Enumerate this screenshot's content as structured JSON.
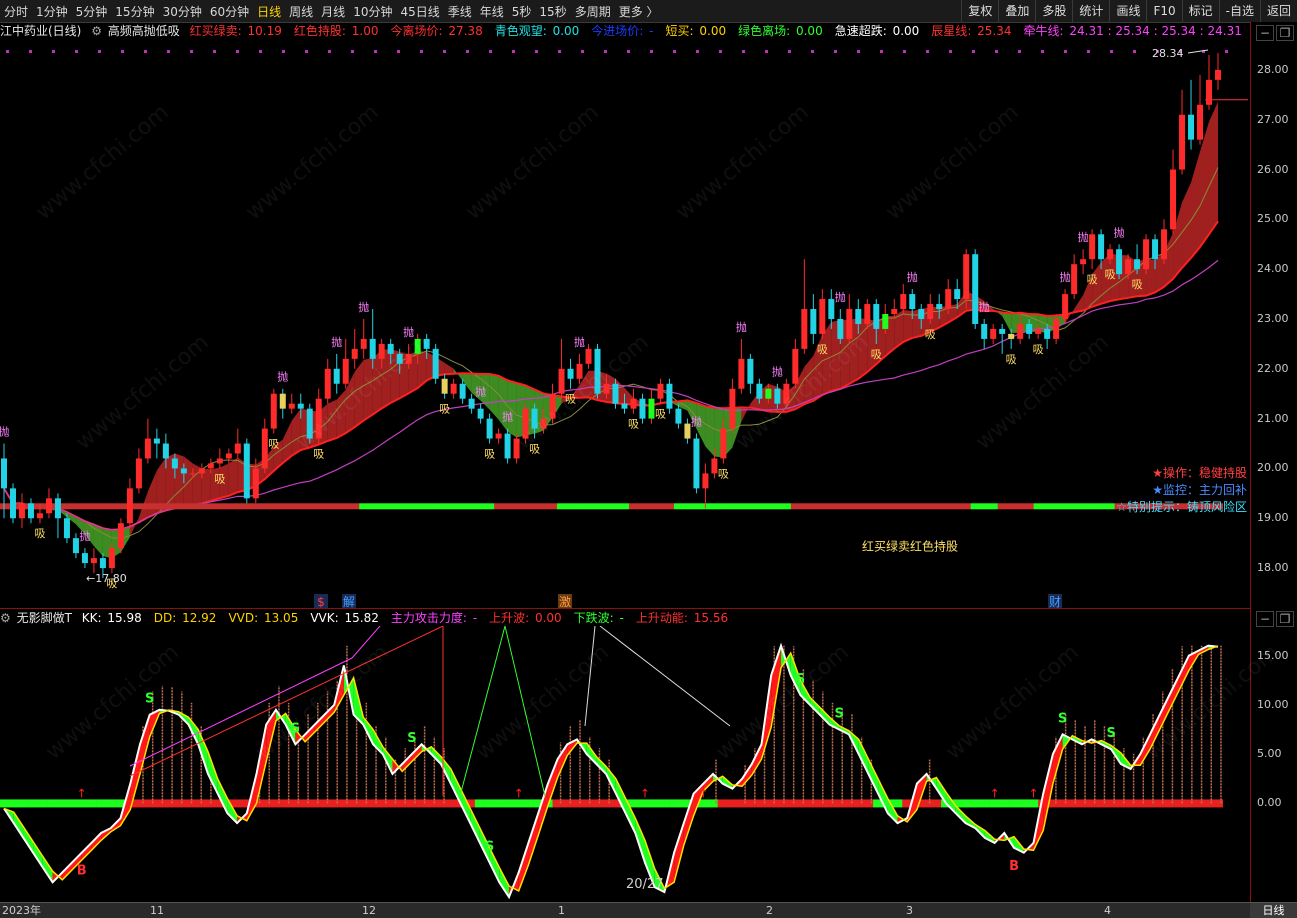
{
  "toolbar": {
    "periods": [
      "分时",
      "1分钟",
      "5分钟",
      "15分钟",
      "30分钟",
      "60分钟",
      "日线",
      "周线",
      "月线",
      "10分钟",
      "45日线",
      "季线",
      "年线",
      "5秒",
      "15秒",
      "多周期",
      "更多 〉"
    ],
    "active_period": "日线",
    "right_buttons": [
      "复权",
      "叠加",
      "多股",
      "统计",
      "画线",
      "F10",
      "标记",
      "-自选",
      "返回"
    ]
  },
  "info": {
    "stock": "江中药业(日线)",
    "indicator": "高频高抛低吸",
    "items": [
      {
        "label": "红买绿卖",
        "value": "10.19",
        "color": "#ff3030"
      },
      {
        "label": "红色持股",
        "value": "1.00",
        "color": "#ff3030"
      },
      {
        "label": "今离场价",
        "value": "27.38",
        "color": "#ff3030"
      },
      {
        "label": "青色观望",
        "value": "0.00",
        "color": "#20e0e0"
      },
      {
        "label": "今进场价",
        "value": "-",
        "color": "#1a3cff"
      },
      {
        "label": "短买",
        "value": "0.00",
        "color": "#ffd200"
      },
      {
        "label": "绿色离场",
        "value": "0.00",
        "color": "#30ff30"
      },
      {
        "label": "急速超跌",
        "value": "0.00",
        "color": "#ffffff"
      },
      {
        "label": "辰星线",
        "value": "25.34",
        "color": "#ff3030"
      },
      {
        "label": "牵牛线",
        "value": "24.31 : 25.34 : 25.34 : 24.31",
        "color": "#ff40ff"
      }
    ]
  },
  "price_axis": [
    "28.00",
    "27.00",
    "26.00",
    "25.00",
    "24.00",
    "23.00",
    "22.00",
    "21.00",
    "20.00",
    "19.00",
    "18.00"
  ],
  "sub_axis": [
    "15.00",
    "10.00",
    "5.00",
    "0.00"
  ],
  "annotations": {
    "high": "28.34",
    "low": "17.80",
    "chart_caption": "红买绿卖红色持股",
    "hints": [
      {
        "star": "★",
        "text": "操作：稳健持股",
        "color": "#ff4040"
      },
      {
        "star": "★",
        "text": "监控：主力回补",
        "color": "#4a8cff"
      },
      {
        "star": "☆",
        "text": "特别提示：铸顶风险区",
        "color": "#40e0ff"
      }
    ],
    "events": [
      "$",
      "解",
      "激",
      "财"
    ],
    "signal_sell": "抛",
    "signal_buy": "吸",
    "signal_s": "S",
    "signal_b": "B",
    "page": "20/27",
    "watermark": "www.cfchi.com"
  },
  "sub": {
    "name": "无影脚做T",
    "items": [
      {
        "label": "KK",
        "value": "15.98",
        "color": "#ffffff"
      },
      {
        "label": "DD",
        "value": "12.92",
        "color": "#ffd200"
      },
      {
        "label": "VVD",
        "value": "13.05",
        "color": "#ffd200"
      },
      {
        "label": "VVK",
        "value": "15.82",
        "color": "#ffffff"
      },
      {
        "label": "主力攻击力度",
        "value": "-",
        "color": "#ff40ff"
      },
      {
        "label": "上升波",
        "value": "0.00",
        "color": "#ff3030"
      },
      {
        "label": "下跌波",
        "value": "-",
        "color": "#30ff30"
      },
      {
        "label": "上升动能",
        "value": "15.56",
        "color": "#ff3030"
      }
    ]
  },
  "time_axis": [
    "2023年",
    "11",
    "12",
    "1",
    "2",
    "3",
    "4"
  ],
  "corner_button": "日线",
  "colors": {
    "up": "#ff2a2a",
    "down": "#22d3e6",
    "green": "#1eff1e",
    "band_red": "#c82828",
    "band_green": "#4caf2a",
    "ma_red": "#ff2020",
    "ma_magenta": "#c040c0"
  },
  "candles": [
    [
      20.2,
      19.6,
      20.5,
      19.0
    ],
    [
      19.6,
      19.0,
      19.7,
      18.9
    ],
    [
      19.0,
      19.3,
      19.5,
      18.8
    ],
    [
      19.3,
      19.0,
      19.4,
      18.9
    ],
    [
      19.0,
      19.1,
      19.3,
      18.9
    ],
    [
      19.1,
      19.4,
      19.6,
      19.0
    ],
    [
      19.4,
      19.0,
      19.5,
      18.6
    ],
    [
      19.0,
      18.6,
      19.1,
      18.5
    ],
    [
      18.6,
      18.3,
      18.7,
      18.2
    ],
    [
      18.3,
      18.1,
      18.4,
      18.0
    ],
    [
      18.1,
      18.2,
      18.4,
      17.9
    ],
    [
      18.2,
      18.0,
      18.3,
      17.8
    ],
    [
      18.0,
      18.4,
      18.5,
      17.9
    ],
    [
      18.4,
      18.9,
      19.0,
      18.3
    ],
    [
      18.9,
      19.6,
      19.8,
      18.8
    ],
    [
      19.6,
      20.2,
      20.4,
      19.5
    ],
    [
      20.2,
      20.6,
      21.0,
      20.1
    ],
    [
      20.6,
      20.5,
      20.8,
      20.2
    ],
    [
      20.5,
      20.2,
      20.7,
      20.0
    ],
    [
      20.2,
      20.0,
      20.3,
      19.8
    ],
    [
      20.0,
      19.9,
      20.1,
      19.7
    ],
    [
      19.9,
      19.9,
      20.0,
      19.8
    ],
    [
      19.9,
      20.0,
      20.1,
      19.8
    ],
    [
      20.0,
      20.1,
      20.2,
      19.9
    ],
    [
      20.1,
      20.2,
      20.4,
      20.0
    ],
    [
      20.2,
      20.3,
      20.4,
      20.1
    ],
    [
      20.3,
      20.5,
      20.8,
      20.2
    ],
    [
      20.5,
      19.4,
      20.6,
      19.3
    ],
    [
      19.4,
      20.0,
      20.2,
      19.3
    ],
    [
      20.0,
      20.8,
      21.0,
      19.9
    ],
    [
      20.8,
      21.5,
      21.6,
      20.7
    ],
    [
      21.5,
      21.2,
      21.6,
      21.0
    ],
    [
      21.2,
      21.3,
      21.5,
      21.1
    ],
    [
      21.3,
      21.2,
      21.5,
      21.0
    ],
    [
      21.2,
      20.6,
      21.3,
      20.5
    ],
    [
      20.6,
      21.4,
      21.6,
      20.5
    ],
    [
      21.4,
      22.0,
      22.2,
      21.3
    ],
    [
      22.0,
      21.7,
      22.3,
      21.5
    ],
    [
      21.7,
      22.2,
      22.6,
      21.6
    ],
    [
      22.2,
      22.4,
      22.8,
      22.0
    ],
    [
      22.4,
      22.6,
      23.0,
      22.2
    ],
    [
      22.6,
      22.2,
      23.2,
      22.0
    ],
    [
      22.2,
      22.5,
      22.6,
      22.0
    ],
    [
      22.5,
      22.3,
      22.6,
      22.1
    ],
    [
      22.3,
      22.1,
      22.4,
      21.9
    ],
    [
      22.1,
      22.3,
      22.5,
      22.0
    ],
    [
      22.3,
      22.6,
      22.7,
      22.1
    ],
    [
      22.6,
      22.4,
      22.7,
      22.2
    ],
    [
      22.4,
      21.8,
      22.5,
      21.7
    ],
    [
      21.8,
      21.5,
      21.9,
      21.4
    ],
    [
      21.5,
      21.7,
      21.8,
      21.4
    ],
    [
      21.7,
      21.4,
      21.8,
      21.3
    ],
    [
      21.4,
      21.2,
      21.5,
      21.1
    ],
    [
      21.2,
      21.0,
      21.3,
      20.9
    ],
    [
      21.0,
      20.6,
      21.1,
      20.5
    ],
    [
      20.6,
      20.7,
      20.8,
      20.5
    ],
    [
      20.7,
      20.2,
      20.8,
      20.1
    ],
    [
      20.2,
      20.6,
      20.7,
      20.1
    ],
    [
      20.6,
      21.2,
      21.3,
      20.5
    ],
    [
      21.2,
      20.8,
      21.3,
      20.6
    ],
    [
      20.8,
      21.0,
      21.2,
      20.7
    ],
    [
      21.0,
      21.5,
      21.7,
      20.9
    ],
    [
      21.5,
      22.0,
      22.6,
      21.4
    ],
    [
      22.0,
      21.8,
      22.2,
      21.6
    ],
    [
      21.8,
      22.1,
      22.3,
      21.7
    ],
    [
      22.1,
      22.4,
      22.5,
      22.0
    ],
    [
      22.4,
      21.5,
      22.5,
      21.4
    ],
    [
      21.5,
      21.7,
      21.9,
      21.4
    ],
    [
      21.7,
      21.3,
      21.8,
      21.2
    ],
    [
      21.3,
      21.2,
      21.5,
      21.1
    ],
    [
      21.2,
      21.4,
      21.6,
      21.1
    ],
    [
      21.4,
      21.0,
      21.5,
      20.9
    ],
    [
      21.0,
      21.4,
      21.6,
      20.9
    ],
    [
      21.4,
      21.7,
      21.8,
      21.3
    ],
    [
      21.7,
      21.2,
      21.8,
      21.1
    ],
    [
      21.2,
      20.9,
      21.3,
      20.8
    ],
    [
      20.9,
      20.6,
      21.0,
      20.5
    ],
    [
      20.6,
      19.6,
      20.7,
      19.5
    ],
    [
      19.6,
      19.9,
      20.1,
      19.2
    ],
    [
      19.9,
      20.2,
      20.4,
      19.8
    ],
    [
      20.2,
      20.8,
      21.0,
      20.1
    ],
    [
      20.8,
      21.6,
      21.8,
      20.7
    ],
    [
      21.6,
      22.2,
      22.6,
      21.5
    ],
    [
      22.2,
      21.7,
      22.3,
      21.5
    ],
    [
      21.7,
      21.4,
      21.8,
      21.3
    ],
    [
      21.4,
      21.6,
      21.7,
      21.3
    ],
    [
      21.6,
      21.3,
      21.7,
      21.2
    ],
    [
      21.3,
      21.7,
      21.8,
      21.2
    ],
    [
      21.7,
      22.4,
      22.6,
      21.6
    ],
    [
      22.4,
      23.2,
      24.2,
      22.3
    ],
    [
      23.2,
      22.7,
      23.5,
      22.5
    ],
    [
      22.7,
      23.4,
      23.6,
      22.6
    ],
    [
      23.4,
      23.0,
      23.6,
      22.8
    ],
    [
      23.0,
      22.6,
      23.2,
      22.5
    ],
    [
      22.6,
      23.2,
      23.5,
      22.5
    ],
    [
      23.2,
      22.9,
      23.4,
      22.7
    ],
    [
      22.9,
      23.3,
      23.4,
      22.8
    ],
    [
      23.3,
      22.8,
      23.4,
      22.5
    ],
    [
      22.8,
      23.1,
      23.3,
      22.7
    ],
    [
      23.1,
      23.2,
      23.4,
      23.0
    ],
    [
      23.2,
      23.5,
      23.7,
      23.1
    ],
    [
      23.5,
      23.2,
      23.6,
      23.0
    ],
    [
      23.2,
      23.0,
      23.3,
      22.8
    ],
    [
      23.0,
      23.3,
      23.5,
      22.9
    ],
    [
      23.3,
      23.2,
      23.5,
      23.0
    ],
    [
      23.2,
      23.6,
      23.8,
      23.1
    ],
    [
      23.6,
      23.4,
      23.8,
      23.2
    ],
    [
      23.4,
      24.3,
      24.4,
      23.2
    ],
    [
      24.3,
      22.9,
      24.4,
      22.8
    ],
    [
      22.9,
      22.6,
      23.0,
      22.4
    ],
    [
      22.6,
      22.8,
      22.9,
      22.5
    ],
    [
      22.8,
      22.7,
      22.9,
      22.3
    ],
    [
      22.7,
      22.6,
      22.8,
      22.4
    ],
    [
      22.6,
      22.9,
      23.1,
      22.5
    ],
    [
      22.9,
      22.7,
      23.0,
      22.6
    ],
    [
      22.7,
      22.8,
      22.9,
      22.6
    ],
    [
      22.8,
      22.6,
      22.9,
      22.4
    ],
    [
      22.6,
      23.0,
      23.1,
      22.5
    ],
    [
      23.0,
      23.5,
      23.6,
      22.9
    ],
    [
      23.5,
      24.1,
      24.3,
      23.4
    ],
    [
      24.1,
      24.2,
      24.4,
      23.9
    ],
    [
      24.2,
      24.7,
      24.8,
      24.0
    ],
    [
      24.7,
      24.2,
      24.8,
      24.0
    ],
    [
      24.2,
      24.4,
      24.5,
      24.1
    ],
    [
      24.4,
      23.9,
      24.5,
      23.8
    ],
    [
      23.9,
      24.2,
      24.3,
      23.8
    ],
    [
      24.2,
      24.0,
      24.5,
      23.9
    ],
    [
      24.0,
      24.6,
      24.7,
      23.9
    ],
    [
      24.6,
      24.2,
      24.7,
      24.0
    ],
    [
      24.2,
      24.8,
      25.0,
      24.1
    ],
    [
      24.8,
      26.0,
      26.4,
      24.7
    ],
    [
      26.0,
      27.1,
      27.6,
      25.9
    ],
    [
      27.1,
      26.6,
      27.8,
      26.4
    ],
    [
      26.6,
      27.3,
      27.9,
      26.5
    ],
    [
      27.3,
      27.8,
      28.3,
      27.2
    ],
    [
      27.8,
      28.0,
      28.34,
      27.6
    ]
  ],
  "sub_series": [
    -0.5,
    -2.0,
    -3.5,
    -5.0,
    -6.5,
    -8.0,
    -7.0,
    -6.0,
    -5.0,
    -4.0,
    -3.0,
    -2.5,
    -1.5,
    2.0,
    6.0,
    9.0,
    9.5,
    9.4,
    9.0,
    8.0,
    6.0,
    3.0,
    1.0,
    -1.0,
    -2.0,
    -1.0,
    3.0,
    8.0,
    9.5,
    8.0,
    6.0,
    7.0,
    8.0,
    9.0,
    10.0,
    14.0,
    9.0,
    8.0,
    6.0,
    5.0,
    3.0,
    4.0,
    5.0,
    6.0,
    5.0,
    4.0,
    2.0,
    0.0,
    -2.0,
    -4.0,
    -6.0,
    -8.0,
    -9.5,
    -7.0,
    -4.0,
    -1.0,
    2.0,
    4.5,
    6.0,
    6.5,
    5.0,
    4.0,
    3.0,
    1.0,
    -1.0,
    -3.0,
    -6.0,
    -8.5,
    -9.0,
    -5.0,
    -2.0,
    1.0,
    2.0,
    3.0,
    2.0,
    1.5,
    2.5,
    4.0,
    6.0,
    13.0,
    16.0,
    13.0,
    11.0,
    10.0,
    9.0,
    8.0,
    7.5,
    7.0,
    5.0,
    3.0,
    1.0,
    -1.0,
    -2.0,
    -1.5,
    2.0,
    3.0,
    1.5,
    0.0,
    -1.0,
    -2.0,
    -2.5,
    -3.5,
    -4.0,
    -3.0,
    -4.5,
    -5.0,
    -4.0,
    1.0,
    5.0,
    7.0,
    6.5,
    6.0,
    6.5,
    6.0,
    5.5,
    4.0,
    3.5,
    5.0,
    7.0,
    9.0,
    11.0,
    13.0,
    15.0,
    15.5,
    16.0,
    15.9
  ]
}
